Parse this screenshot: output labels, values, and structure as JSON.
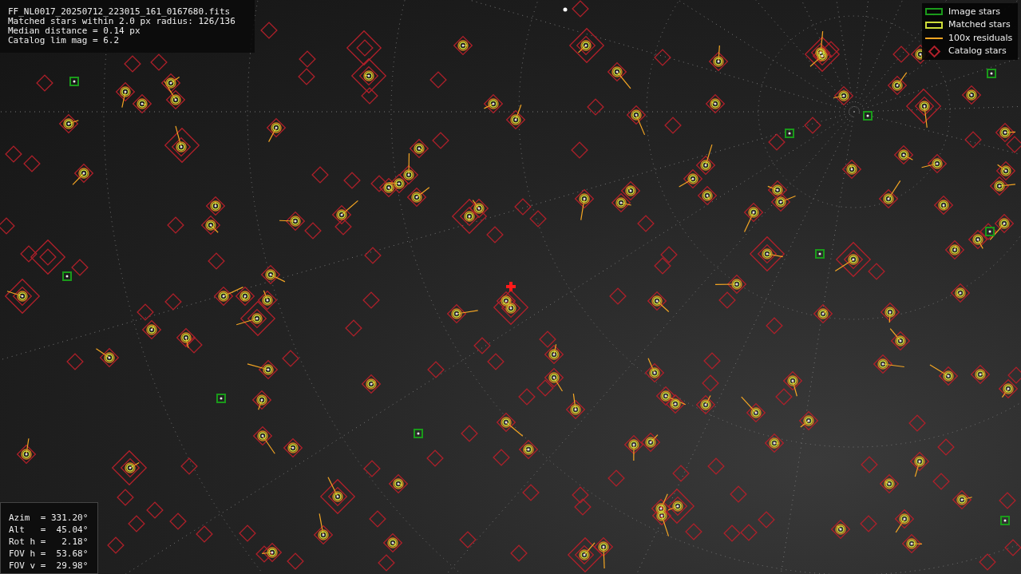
{
  "info": {
    "lines": [
      "FF_NL0017_20250712_223015_161_0167680.fits",
      "Matched stars within 2.0 px radius: 126/136",
      "Median distance = 0.14 px",
      "Catalog lim mag = 6.2"
    ]
  },
  "legend": [
    {
      "kind": "image",
      "label": "Image stars"
    },
    {
      "kind": "matched",
      "label": "Matched stars"
    },
    {
      "kind": "residual",
      "label": "100x residuals"
    },
    {
      "kind": "catalog",
      "label": "Catalog stars"
    }
  ],
  "pointing": {
    "lines": [
      "Azim  = 331.20°",
      "Alt   =  45.04°",
      "Rot h =   2.18°",
      "FOV h =  53.68°",
      "FOV v =  29.98°"
    ]
  }
}
